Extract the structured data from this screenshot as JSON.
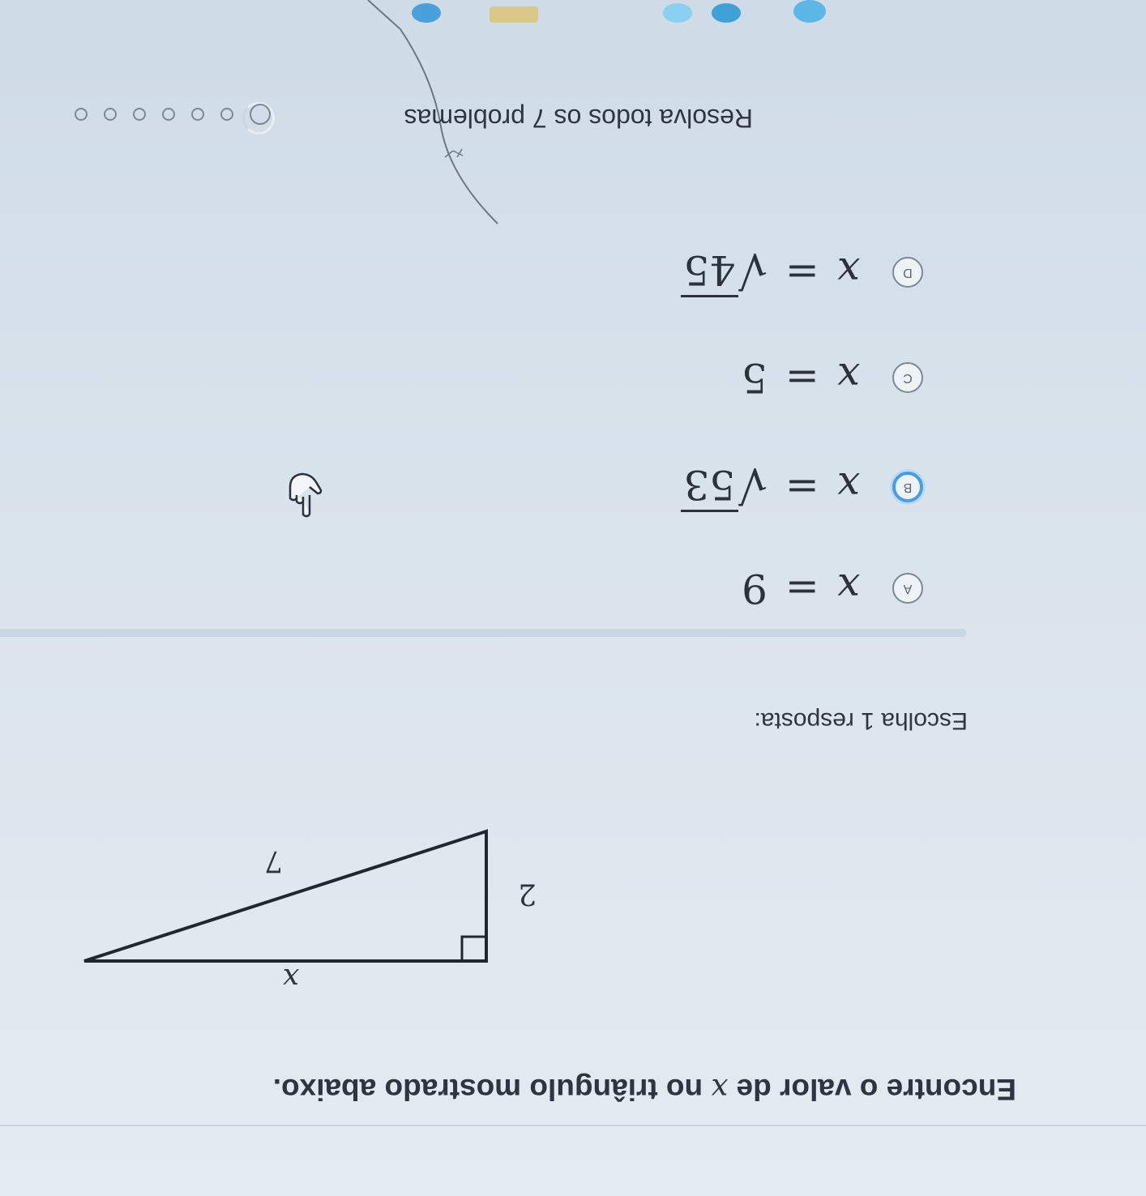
{
  "question": {
    "prefix": "Encontre o valor de ",
    "variable": "x",
    "suffix": " no triângulo mostrado abaixo."
  },
  "triangle": {
    "hypotenuse_label": "7",
    "leg_label": "2",
    "unknown_label": "x"
  },
  "instruction": "Escolha 1 resposta:",
  "options": [
    {
      "letter": "A",
      "var": "x",
      "eq": "=",
      "value": "9",
      "sqrt": false,
      "selected": false
    },
    {
      "letter": "B",
      "var": "x",
      "eq": "=",
      "value": "53",
      "sqrt": true,
      "selected": true
    },
    {
      "letter": "C",
      "var": "x",
      "eq": "=",
      "value": "5",
      "sqrt": false,
      "selected": false
    },
    {
      "letter": "D",
      "var": "x",
      "eq": "=",
      "value": "45",
      "sqrt": true,
      "selected": false
    }
  ],
  "footer": {
    "progress_text_prefix": "Resolva todos os ",
    "progress_count": "7",
    "progress_text_suffix": " problemas"
  },
  "colors": {
    "selected_accent": "#4a9be8",
    "text": "#2d3540",
    "background": "#dfe7ef"
  },
  "icons": {
    "cursor": "pointing-hand-icon",
    "radio": "radio-icon",
    "progress": "progress-dot-icon"
  }
}
